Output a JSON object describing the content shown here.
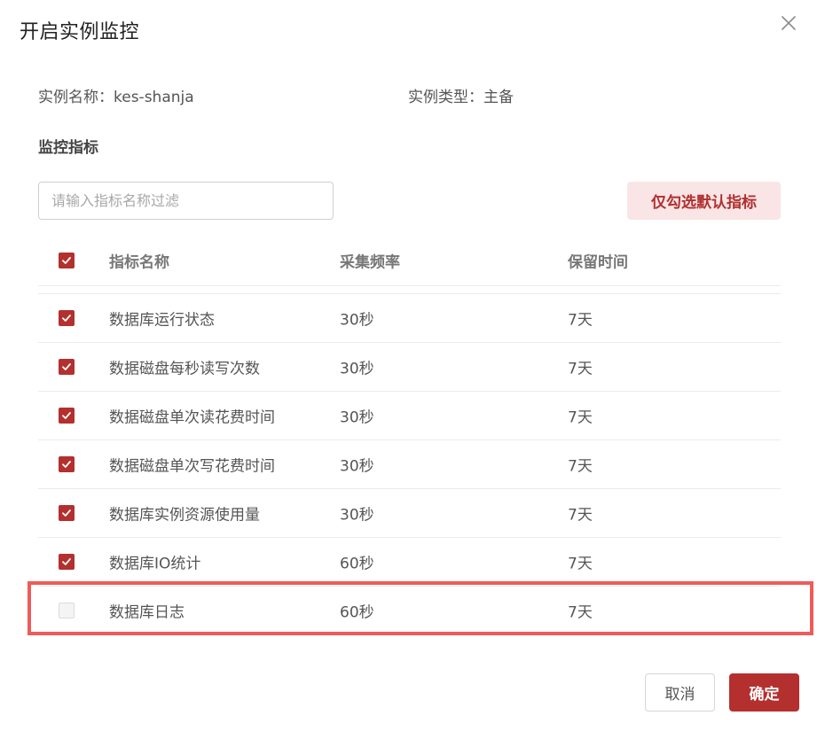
{
  "dialog": {
    "title": "开启实例监控"
  },
  "info": {
    "instance_name": "实例名称：kes-shanja",
    "instance_type": "实例类型：主备"
  },
  "section": {
    "title": "监控指标"
  },
  "filter": {
    "placeholder": "请输入指标名称过滤",
    "value": ""
  },
  "actions": {
    "default_metrics_label": "仅勾选默认指标",
    "cancel_label": "取消",
    "confirm_label": "确定"
  },
  "table": {
    "header": {
      "name": "指标名称",
      "frequency": "采集频率",
      "retention": "保留时间",
      "all_checked": true
    },
    "rows": [
      {
        "name": "数据库运行状态",
        "frequency": "30秒",
        "retention": "7天",
        "checked": true
      },
      {
        "name": "数据磁盘每秒读写次数",
        "frequency": "30秒",
        "retention": "7天",
        "checked": true
      },
      {
        "name": "数据磁盘单次读花费时间",
        "frequency": "30秒",
        "retention": "7天",
        "checked": true
      },
      {
        "name": "数据磁盘单次写花费时间",
        "frequency": "30秒",
        "retention": "7天",
        "checked": true
      },
      {
        "name": "数据库实例资源使用量",
        "frequency": "30秒",
        "retention": "7天",
        "checked": true
      },
      {
        "name": "数据库IO统计",
        "frequency": "60秒",
        "retention": "7天",
        "checked": true
      },
      {
        "name": "数据库日志",
        "frequency": "60秒",
        "retention": "7天",
        "checked": false
      }
    ]
  },
  "colors": {
    "accent": "#b3302e",
    "highlight": "#ef5b5b"
  },
  "icons": {
    "close": "close-icon",
    "check": "check-icon"
  }
}
